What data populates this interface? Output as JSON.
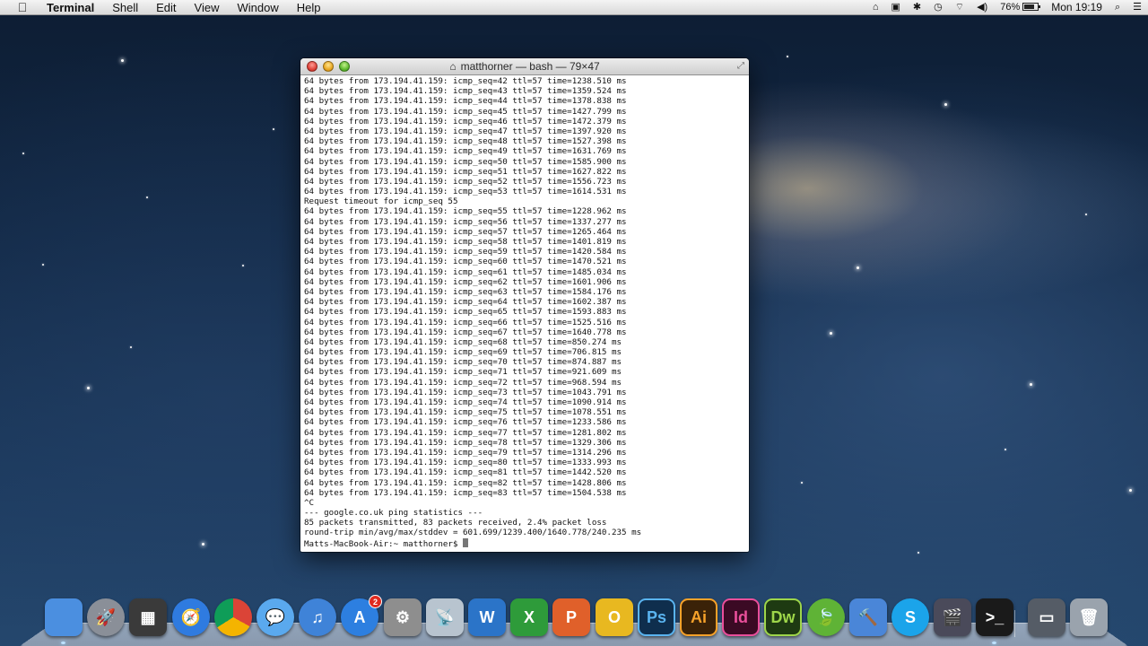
{
  "menubar": {
    "app_name": "Terminal",
    "menus": [
      "Shell",
      "Edit",
      "View",
      "Window",
      "Help"
    ],
    "battery": "76%",
    "clock": "Mon 19:19"
  },
  "window": {
    "title": "matthorner — bash — 79×47",
    "lines": [
      "64 bytes from 173.194.41.159: icmp_seq=42 ttl=57 time=1238.510 ms",
      "64 bytes from 173.194.41.159: icmp_seq=43 ttl=57 time=1359.524 ms",
      "64 bytes from 173.194.41.159: icmp_seq=44 ttl=57 time=1378.838 ms",
      "64 bytes from 173.194.41.159: icmp_seq=45 ttl=57 time=1427.799 ms",
      "64 bytes from 173.194.41.159: icmp_seq=46 ttl=57 time=1472.379 ms",
      "64 bytes from 173.194.41.159: icmp_seq=47 ttl=57 time=1397.920 ms",
      "64 bytes from 173.194.41.159: icmp_seq=48 ttl=57 time=1527.398 ms",
      "64 bytes from 173.194.41.159: icmp_seq=49 ttl=57 time=1631.769 ms",
      "64 bytes from 173.194.41.159: icmp_seq=50 ttl=57 time=1585.900 ms",
      "64 bytes from 173.194.41.159: icmp_seq=51 ttl=57 time=1627.822 ms",
      "64 bytes from 173.194.41.159: icmp_seq=52 ttl=57 time=1556.723 ms",
      "64 bytes from 173.194.41.159: icmp_seq=53 ttl=57 time=1614.531 ms",
      "Request timeout for icmp_seq 55",
      "64 bytes from 173.194.41.159: icmp_seq=55 ttl=57 time=1228.962 ms",
      "64 bytes from 173.194.41.159: icmp_seq=56 ttl=57 time=1337.277 ms",
      "64 bytes from 173.194.41.159: icmp_seq=57 ttl=57 time=1265.464 ms",
      "64 bytes from 173.194.41.159: icmp_seq=58 ttl=57 time=1401.819 ms",
      "64 bytes from 173.194.41.159: icmp_seq=59 ttl=57 time=1420.584 ms",
      "64 bytes from 173.194.41.159: icmp_seq=60 ttl=57 time=1470.521 ms",
      "64 bytes from 173.194.41.159: icmp_seq=61 ttl=57 time=1485.034 ms",
      "64 bytes from 173.194.41.159: icmp_seq=62 ttl=57 time=1601.906 ms",
      "64 bytes from 173.194.41.159: icmp_seq=63 ttl=57 time=1584.176 ms",
      "64 bytes from 173.194.41.159: icmp_seq=64 ttl=57 time=1602.387 ms",
      "64 bytes from 173.194.41.159: icmp_seq=65 ttl=57 time=1593.883 ms",
      "64 bytes from 173.194.41.159: icmp_seq=66 ttl=57 time=1525.516 ms",
      "64 bytes from 173.194.41.159: icmp_seq=67 ttl=57 time=1640.778 ms",
      "64 bytes from 173.194.41.159: icmp_seq=68 ttl=57 time=850.274 ms",
      "64 bytes from 173.194.41.159: icmp_seq=69 ttl=57 time=706.815 ms",
      "64 bytes from 173.194.41.159: icmp_seq=70 ttl=57 time=874.887 ms",
      "64 bytes from 173.194.41.159: icmp_seq=71 ttl=57 time=921.609 ms",
      "64 bytes from 173.194.41.159: icmp_seq=72 ttl=57 time=968.594 ms",
      "64 bytes from 173.194.41.159: icmp_seq=73 ttl=57 time=1043.791 ms",
      "64 bytes from 173.194.41.159: icmp_seq=74 ttl=57 time=1090.914 ms",
      "64 bytes from 173.194.41.159: icmp_seq=75 ttl=57 time=1078.551 ms",
      "64 bytes from 173.194.41.159: icmp_seq=76 ttl=57 time=1233.586 ms",
      "64 bytes from 173.194.41.159: icmp_seq=77 ttl=57 time=1281.802 ms",
      "64 bytes from 173.194.41.159: icmp_seq=78 ttl=57 time=1329.306 ms",
      "64 bytes from 173.194.41.159: icmp_seq=79 ttl=57 time=1314.296 ms",
      "64 bytes from 173.194.41.159: icmp_seq=80 ttl=57 time=1333.993 ms",
      "64 bytes from 173.194.41.159: icmp_seq=81 ttl=57 time=1442.520 ms",
      "64 bytes from 173.194.41.159: icmp_seq=82 ttl=57 time=1428.806 ms",
      "64 bytes from 173.194.41.159: icmp_seq=83 ttl=57 time=1504.538 ms",
      "^C",
      "--- google.co.uk ping statistics ---",
      "85 packets transmitted, 83 packets received, 2.4% packet loss",
      "round-trip min/avg/max/stddev = 601.699/1239.400/1640.778/240.235 ms"
    ],
    "prompt": "Matts-MacBook-Air:~ matthorner$ "
  },
  "dock": {
    "items": [
      {
        "name": "finder",
        "label": "",
        "bg": "#4b8fe0",
        "icon": "finder-icon"
      },
      {
        "name": "launchpad",
        "label": "🚀",
        "bg": "#8a8f98",
        "icon": "rocket-icon",
        "round": true
      },
      {
        "name": "photo-booth",
        "label": "▦",
        "bg": "#3a3a3a",
        "icon": "photo-booth-icon"
      },
      {
        "name": "safari",
        "label": "🧭",
        "bg": "#2f7be0",
        "icon": "compass-icon",
        "round": true
      },
      {
        "name": "chrome",
        "label": "",
        "bg": "conic-gradient(#db4437 0 33%, #f4b400 0 66%, #0f9d58 0)",
        "icon": "chrome-icon",
        "round": true
      },
      {
        "name": "messages",
        "label": "💬",
        "bg": "#5aa9ee",
        "icon": "speech-bubble-icon",
        "round": true
      },
      {
        "name": "itunes",
        "label": "♫",
        "bg": "#3f83d8",
        "icon": "music-note-icon",
        "round": true
      },
      {
        "name": "app-store",
        "label": "A",
        "bg": "#2d7fe0",
        "icon": "app-store-icon",
        "round": true,
        "badge": "2"
      },
      {
        "name": "system-preferences",
        "label": "⚙",
        "bg": "#8e8e8e",
        "icon": "gear-icon"
      },
      {
        "name": "network-utility",
        "label": "📡",
        "bg": "#b8c4cf",
        "icon": "satellite-dish-icon"
      },
      {
        "name": "word",
        "label": "W",
        "bg": "#2b74c8",
        "icon": "word-icon"
      },
      {
        "name": "excel",
        "label": "X",
        "bg": "#2e9b3a",
        "icon": "excel-icon"
      },
      {
        "name": "powerpoint",
        "label": "P",
        "bg": "#e0602a",
        "icon": "powerpoint-icon"
      },
      {
        "name": "outlook",
        "label": "O",
        "bg": "#e8b820",
        "icon": "outlook-icon"
      },
      {
        "name": "photoshop",
        "label": "Ps",
        "bg": "#0f2e4d",
        "icon": "photoshop-icon",
        "fg": "#5ab4f0"
      },
      {
        "name": "illustrator",
        "label": "Ai",
        "bg": "#3a2208",
        "icon": "illustrator-icon",
        "fg": "#f7a22a"
      },
      {
        "name": "indesign",
        "label": "Id",
        "bg": "#3b0a24",
        "icon": "indesign-icon",
        "fg": "#ea4f9b"
      },
      {
        "name": "dreamweaver",
        "label": "Dw",
        "bg": "#1e3a12",
        "icon": "dreamweaver-icon",
        "fg": "#9ed64a"
      },
      {
        "name": "evernote",
        "label": "🍃",
        "bg": "#5fb336",
        "icon": "leaf-icon",
        "round": true
      },
      {
        "name": "xcode",
        "label": "🔨",
        "bg": "#4a86d8",
        "icon": "hammer-icon"
      },
      {
        "name": "skype",
        "label": "S",
        "bg": "#1ba4ea",
        "icon": "skype-icon",
        "round": true
      },
      {
        "name": "imovie",
        "label": "🎬",
        "bg": "#4a4a5a",
        "icon": "movie-clapper-icon"
      },
      {
        "name": "terminal",
        "label": ">_",
        "bg": "#1a1a1a",
        "icon": "terminal-icon"
      },
      {
        "name": "downloads-stack",
        "label": "▭",
        "bg": "#555c66",
        "icon": "stack-icon"
      },
      {
        "name": "trash",
        "label": "🗑",
        "bg": "#9aa3ad",
        "icon": "trash-icon"
      }
    ]
  }
}
